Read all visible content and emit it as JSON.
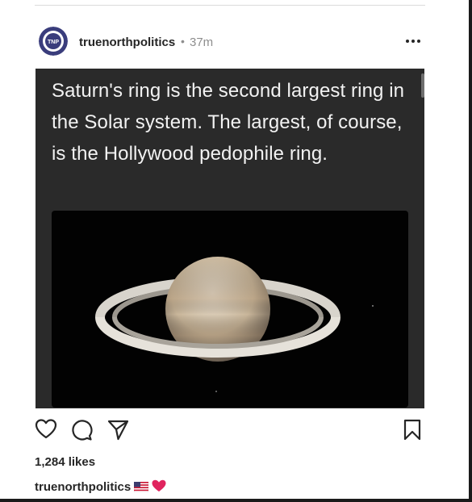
{
  "post": {
    "username": "truenorthpolitics",
    "separator": "•",
    "time_ago": "37m",
    "avatar_text": "TNP",
    "meme_text": "Saturn's ring is the second largest ring in the Solar system. The largest, of course, is the Hollywood pedophile ring.",
    "likes_text": "1,284 likes",
    "caption_user": "truenorthpolitics",
    "caption_emojis": [
      "us-flag",
      "red-heart"
    ]
  },
  "icons": {
    "more": "more-options-icon",
    "like": "heart-icon",
    "comment": "comment-icon",
    "share": "send-icon",
    "save": "bookmark-icon"
  },
  "colors": {
    "avatar_bg": "#3a3d7c",
    "text_primary": "#262626",
    "text_secondary": "#8e8e8e",
    "image_bg": "#2a2a2a",
    "heart": "#e0245e"
  }
}
